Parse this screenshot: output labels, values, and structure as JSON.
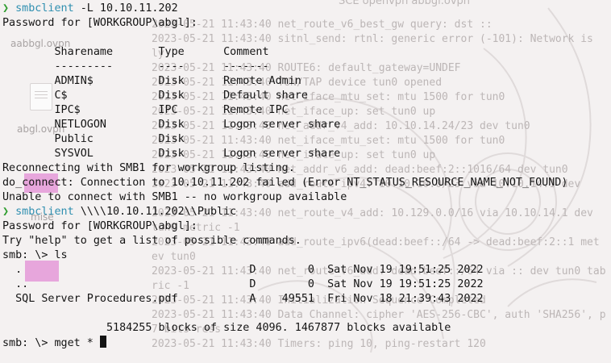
{
  "desktop": {
    "window_title": "SCE openvpn abbgl.ovpn",
    "files": [
      {
        "name": "aabbgl.ovpn",
        "icon": "document-icon"
      },
      {
        "name": "abgl.ovpn",
        "icon": "document-icon"
      }
    ],
    "partial_label": "mise"
  },
  "log_lines": [
    "2023-05-21 11:43:40 net_route_v6_best_gw query: dst ::",
    "2023-05-21 11:43:40 sitnl_send: rtnl: generic error (-101): Network is",
    "ly",
    "2023-05-21 11:43:40 ROUTE6: default_gateway=UNDEF",
    "2023-05-21 11:43:40 TUN/TAP device tun0 opened",
    "2023-05-21 11:43:40 net_iface_mtu_set: mtu 1500 for tun0",
    "2023-05-21 11:43:40 net_iface_up: set tun0 up",
    "2023-05-21 11:43:40 net_addr_v4_add: 10.10.14.24/23 dev tun0",
    "2023-05-21 11:43:40 net_iface_mtu_set: mtu 1500 for tun0",
    "2023-05-21 11:43:40 net_iface_up: set tun0 up",
    "2023-05-21 11:43:40 net_addr_v6_add: dead:beef:2::1016/64 dev tun0",
    "2023-05-21 11:43:40 add_route_ipv4: 10.10.10.0/23 via 10.10.14.1 dev",
    "",
    "2023-05-21 11:43:40 net_route_v4_add: 10.129.0.0/16 via 10.10.14.1 dev",
    "tun0 metric -1",
    "2023-05-21 11:43:40 add_route_ipv6(dead:beef::/64 -> dead:beef:2::1 met",
    "ev tun0",
    "2023-05-21 11:43:40 net_route_v6_add: dead:beef::/64 via :: dev tun0 tab",
    "ric -1",
    "2023-05-21 11:43:40 Initialization Sequence Completed",
    "2023-05-21 11:43:40 Data Channel: cipher 'AES-256-CBC', auth 'SHA256', p",
    "7 bits ress",
    "2023-05-21 11:43:40 Timers: ping 10, ping-restart 120"
  ],
  "terminal": {
    "prompt_symbol": "❯",
    "lines": [
      {
        "type": "cmd",
        "cmd": "smbclient",
        "args": " -L 10.10.11.202"
      },
      {
        "type": "text",
        "text": "Password for [WORKGROUP\\abgl]:"
      },
      {
        "type": "text",
        "text": ""
      },
      {
        "type": "text",
        "text": "        Sharename       Type      Comment"
      },
      {
        "type": "text",
        "text": "        ---------       ----      -------"
      },
      {
        "type": "text",
        "text": "        ADMIN$          Disk      Remote Admin"
      },
      {
        "type": "text",
        "text": "        C$              Disk      Default share"
      },
      {
        "type": "text",
        "text": "        IPC$            IPC       Remote IPC"
      },
      {
        "type": "text",
        "text": "        NETLOGON        Disk      Logon server share"
      },
      {
        "type": "text",
        "text": "        Public          Disk"
      },
      {
        "type": "text",
        "text": "        SYSVOL          Disk      Logon server share"
      },
      {
        "type": "text",
        "text": "Reconnecting with SMB1 for workgroup listing."
      },
      {
        "type": "text",
        "text": "do_connect: Connection to 10.10.11.202 failed (Error NT_STATUS_RESOURCE_NAME_NOT_FOUND)"
      },
      {
        "type": "text",
        "text": "Unable to connect with SMB1 -- no workgroup available"
      },
      {
        "type": "cmd",
        "cmd": "smbclient",
        "args": " \\\\\\\\10.10.11.202\\\\Public"
      },
      {
        "type": "text",
        "text": "Password for [WORKGROUP\\abgl]:"
      },
      {
        "type": "text",
        "text": "Try \"help\" to get a list of possible commands."
      },
      {
        "type": "text",
        "text": "smb: \\> ls"
      },
      {
        "type": "text",
        "text": "  .                                   D        0  Sat Nov 19 19:51:25 2022"
      },
      {
        "type": "text",
        "text": "  ..                                  D        0  Sat Nov 19 19:51:25 2022"
      },
      {
        "type": "text",
        "text": "  SQL Server Procedures.pdf           A    49551  Fri Nov 18 21:39:43 2022"
      },
      {
        "type": "text",
        "text": ""
      },
      {
        "type": "text",
        "text": "                5184255 blocks of size 4096. 1467877 blocks available"
      },
      {
        "type": "text",
        "text": "smb: \\> mget *"
      }
    ]
  },
  "colors": {
    "prompt": "#2e9d2e",
    "command": "#2f8fb0",
    "text": "#141414",
    "log_text": "#bcb6b6",
    "highlight": "#e7a6dc"
  }
}
